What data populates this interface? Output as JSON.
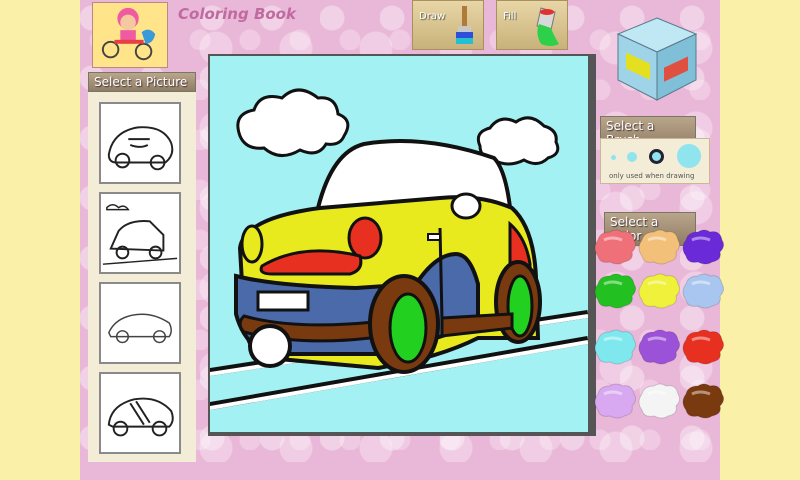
{
  "app": {
    "title": "Coloring Book"
  },
  "toolbar": {
    "draw_label": "Draw",
    "fill_label": "Fill"
  },
  "pictures": {
    "label": "Select a Picture"
  },
  "brush": {
    "label": "Select a Brush",
    "note": "only used when drawing"
  },
  "colors": {
    "label": "Select a Color",
    "swatches": [
      "#f0707a",
      "#f3c07a",
      "#6a2ad8",
      "#22c020",
      "#eff13a",
      "#a8c6f0",
      "#7ee8ee",
      "#9b52d8",
      "#e83020",
      "#d8a8f0",
      "#f4f4f4",
      "#7a3a10"
    ]
  }
}
